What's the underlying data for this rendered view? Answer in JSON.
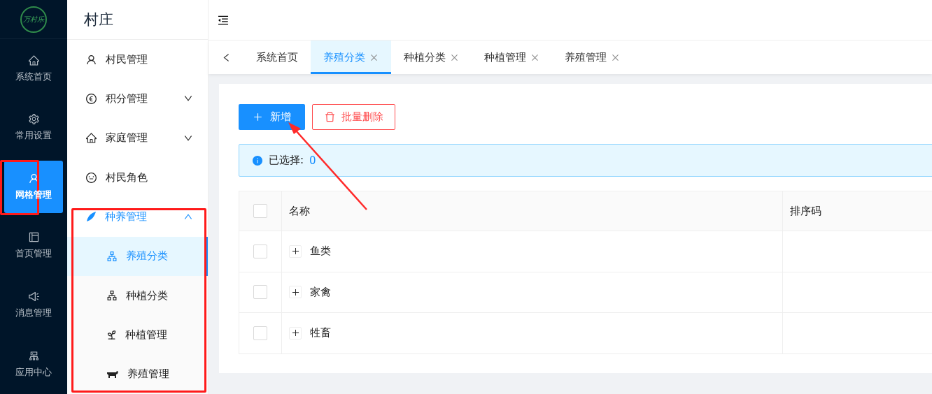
{
  "logo": {
    "text": "万村乐"
  },
  "rail": [
    {
      "label": "系统首页",
      "selected": false
    },
    {
      "label": "常用设置",
      "selected": false
    },
    {
      "label": "网格管理",
      "selected": true
    },
    {
      "label": "首页管理",
      "selected": false
    },
    {
      "label": "消息管理",
      "selected": false
    },
    {
      "label": "应用中心",
      "selected": false
    }
  ],
  "sidebar": {
    "title": "村庄",
    "items": [
      {
        "label": "村民管理",
        "selected": false
      },
      {
        "label": "积分管理",
        "selected": false,
        "expanded": false
      },
      {
        "label": "家庭管理",
        "selected": false,
        "expanded": false
      },
      {
        "label": "村民角色",
        "selected": false
      },
      {
        "label": "种养管理",
        "selected": false,
        "expanded": true,
        "children": [
          {
            "label": "养殖分类",
            "selected": true
          },
          {
            "label": "种植分类",
            "selected": false
          },
          {
            "label": "种植管理",
            "selected": false
          },
          {
            "label": "养殖管理",
            "selected": false
          }
        ]
      }
    ]
  },
  "tabs": [
    {
      "label": "系统首页",
      "selected": false,
      "closable": false
    },
    {
      "label": "养殖分类",
      "selected": true,
      "closable": true
    },
    {
      "label": "种植分类",
      "selected": false,
      "closable": true
    },
    {
      "label": "种植管理",
      "selected": false,
      "closable": true
    },
    {
      "label": "养殖管理",
      "selected": false,
      "closable": true
    }
  ],
  "toolbar": {
    "add": "新增",
    "delete": "批量删除"
  },
  "alert": {
    "label": "已选择:",
    "count": "0"
  },
  "table": {
    "select_all": {
      "checked": false
    },
    "columns": [
      "名称",
      "排序码"
    ],
    "rows": [
      {
        "name": "鱼类",
        "checked": false
      },
      {
        "name": "家禽",
        "checked": false
      },
      {
        "name": "牲畜",
        "checked": false
      }
    ]
  }
}
